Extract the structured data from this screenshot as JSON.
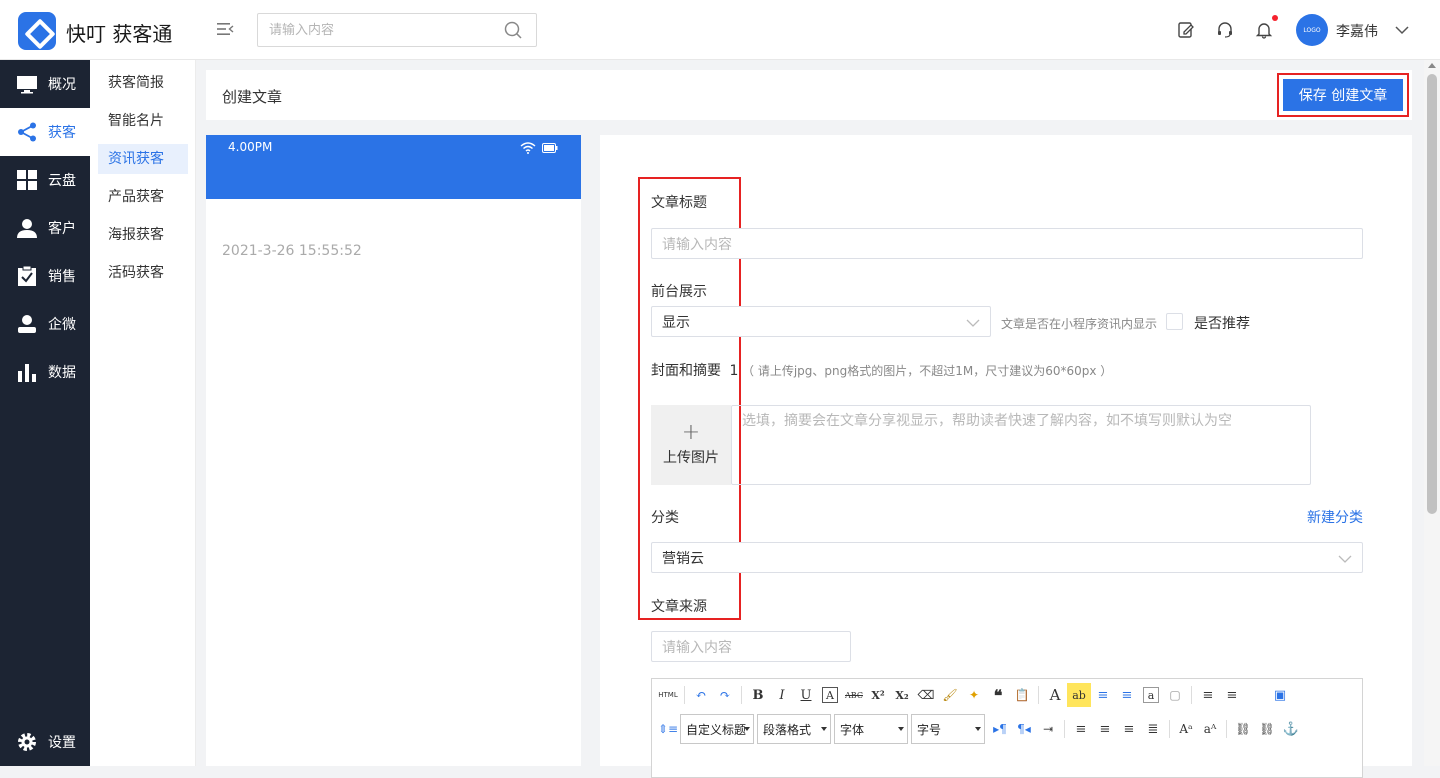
{
  "app": {
    "name": "快叮 获客通"
  },
  "header": {
    "search_placeholder": "请输入内容",
    "username": "李嘉伟",
    "avatar_text": "LOGO"
  },
  "sidebar": {
    "items": [
      {
        "label": "概况",
        "icon": "monitor-icon"
      },
      {
        "label": "获客",
        "icon": "share-icon",
        "active": true
      },
      {
        "label": "云盘",
        "icon": "grid-icon"
      },
      {
        "label": "客户",
        "icon": "user-icon"
      },
      {
        "label": "销售",
        "icon": "clipboard-check-icon"
      },
      {
        "label": "企微",
        "icon": "person-icon"
      },
      {
        "label": "数据",
        "icon": "bar-chart-icon"
      }
    ],
    "settings_label": "设置"
  },
  "subnav": {
    "items": [
      {
        "label": "获客简报"
      },
      {
        "label": "智能名片"
      },
      {
        "label": "资讯获客",
        "active": true
      },
      {
        "label": "产品获客"
      },
      {
        "label": "海报获客"
      },
      {
        "label": "活码获客"
      }
    ]
  },
  "page": {
    "title": "创建文章",
    "save_button": "保存 创建文章"
  },
  "preview": {
    "time": "4.00PM",
    "date": "2021-3-26 15:55:52"
  },
  "form": {
    "title_label": "文章标题",
    "title_placeholder": "请输入内容",
    "display_label": "前台展示",
    "display_value": "显示",
    "display_hint": "文章是否在小程序资讯内显示",
    "recommend_label": "是否推荐",
    "cover_label": "封面和摘要",
    "cover_required": "1",
    "cover_hint": "（ 请上传jpg、png格式的图片，不超过1M，尺寸建议为60*60px ）",
    "upload_label": "上传图片",
    "summary_placeholder": "选填，摘要会在文章分享视显示，帮助读者快速了解内容，如不填写则默认为空",
    "category_label": "分类",
    "new_category_link": "新建分类",
    "category_value": "营销云",
    "source_label": "文章来源",
    "source_placeholder": "请输入内容"
  },
  "editor": {
    "toolbar_row1": [
      "HTML",
      "↶",
      "↷",
      "B",
      "I",
      "U",
      "A",
      "ABC",
      "X²",
      "X₂",
      "⌫",
      "🖌",
      "✦",
      "❝",
      "📋",
      "A",
      "ab",
      "≡",
      "≡",
      "a",
      "▢",
      "≡",
      "≡",
      "▣"
    ],
    "selects": [
      "自定义标题",
      "段落格式",
      "字体",
      "字号"
    ]
  },
  "colors": {
    "primary": "#2b73e6",
    "sidebar": "#1c2433",
    "highlight": "#e62222"
  }
}
